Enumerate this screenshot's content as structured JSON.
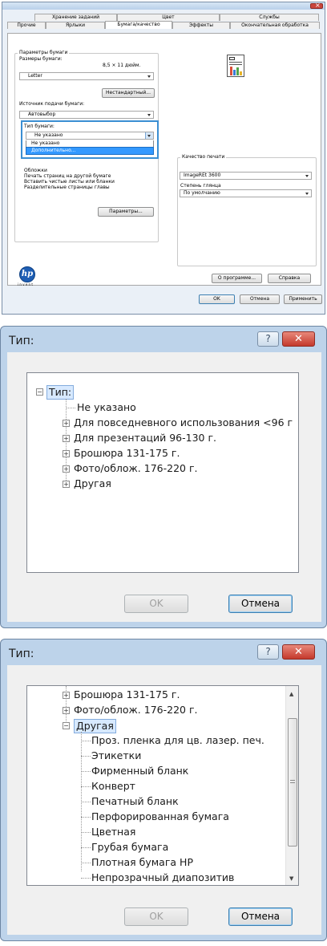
{
  "panel1": {
    "tabs_row1": [
      "Хранение заданий",
      "Цвет",
      "Службы"
    ],
    "tabs_row2": [
      "Прочие",
      "Ярлыки",
      "Бумага/качество",
      "Эффекты",
      "Окончательная обработка"
    ],
    "paper_params_label": "Параметры бумаги",
    "paper_sizes_label": "Размеры бумаги:",
    "paper_size_value": "8,5 × 11 дюйм.",
    "paper_size_select": "Letter",
    "custom_button": "Нестандартный...",
    "paper_source_label": "Источник подачи бумаги:",
    "paper_source_select": "Автовыбор",
    "paper_type_label": "Тип бумаги:",
    "paper_type_select": "Не указано",
    "paper_type_options": [
      "Не указано",
      "Дополнительно..."
    ],
    "special_pages_label": "Обложки",
    "special_pages": [
      "Печать страниц на другой бумаге",
      "Вставить чистые листы или бланки",
      "Разделительные страницы главы"
    ],
    "parameters_button": "Параметры...",
    "print_quality_label": "Качество печати",
    "quality_select": "ImageREt 3600",
    "gloss_label": "Степень глянца",
    "gloss_select": "По умолчанию",
    "logo_text": "hp",
    "invent_text": "i n v e n t",
    "about_button": "О программе...",
    "help_button": "Справка",
    "ok_button": "OK",
    "cancel_button": "Отмена",
    "apply_button": "Применить"
  },
  "dialog1": {
    "title": "Тип:",
    "help_glyph": "?",
    "close_glyph": "✕",
    "tree": {
      "root": "Тип:",
      "items": [
        {
          "label": "Не указано",
          "expandable": false
        },
        {
          "label": "Для повседневного использования <96 г",
          "expandable": true
        },
        {
          "label": "Для презентаций 96-130 г.",
          "expandable": true
        },
        {
          "label": "Брошюра 131-175 г.",
          "expandable": true
        },
        {
          "label": "Фото/облож. 176-220 г.",
          "expandable": true
        },
        {
          "label": "Другая",
          "expandable": true
        }
      ]
    },
    "ok_button": "OK",
    "cancel_button": "Отмена"
  },
  "dialog2": {
    "title": "Тип:",
    "help_glyph": "?",
    "close_glyph": "✕",
    "tree": {
      "collapsed": [
        "Брошюра 131-175 г.",
        "Фото/облож. 176-220 г."
      ],
      "expanded": "Другая",
      "children": [
        "Проз. пленка для цв. лазер. печ.",
        "Этикетки",
        "Фирменный бланк",
        "Конверт",
        "Печатный бланк",
        "Перфорированная бумага",
        "Цветная",
        "Грубая бумага",
        "Плотная бумага HP",
        "Непрозрачный диапозитив"
      ]
    },
    "ok_button": "OK",
    "cancel_button": "Отмена"
  }
}
